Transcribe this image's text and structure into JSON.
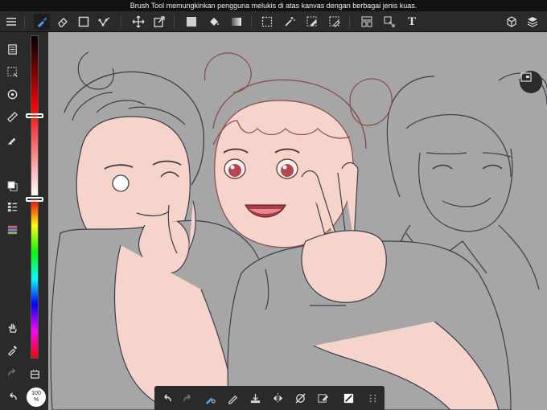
{
  "status": {
    "tooltip": "Brush Tool memungkinkan pengguna melukis di atas kanvas dengan berbagai jenis kuas."
  },
  "toolbar": {
    "text_tool_label": "T",
    "icons": [
      "menu-icon",
      "brush-icon",
      "eraser-icon",
      "rectangle-icon",
      "curve-icon",
      "move-icon",
      "transform-icon",
      "fill-color-icon",
      "bucket-icon",
      "gradient-icon",
      "select-icon",
      "magic-wand-icon",
      "select-pen-icon",
      "select-eraser-icon",
      "frame-icon",
      "operation-icon",
      "text-icon",
      "3d-icon",
      "layers-icon"
    ]
  },
  "sidebar": {
    "icons": [
      "page-icon",
      "selection-icon",
      "rotate-icon",
      "ruler-icon",
      "snap-pen-icon",
      "color-swatch-icon",
      "layer-list-icon",
      "palette-icon",
      "hand-icon",
      "eyedropper-icon",
      "redo-icon",
      "undo-icon",
      "grid-icon"
    ]
  },
  "zoom": {
    "value": "100",
    "unit": "%"
  },
  "colors": {
    "primary": "#ffffff",
    "secondary": "#1f1f1f",
    "canvas_bg": "#a6a6a6",
    "skin": "#f6d3cb",
    "lineart": "#3a3a46",
    "active_tool": "#4aa3ff"
  },
  "bottom_bar": {
    "icons": [
      "undo-icon",
      "redo-icon",
      "brush-size-icon",
      "pen-icon",
      "import-icon",
      "symmetry-icon",
      "rotate-lock-icon",
      "canvas-edit-icon",
      "layer-mode-icon",
      "grid-menu-icon"
    ]
  }
}
